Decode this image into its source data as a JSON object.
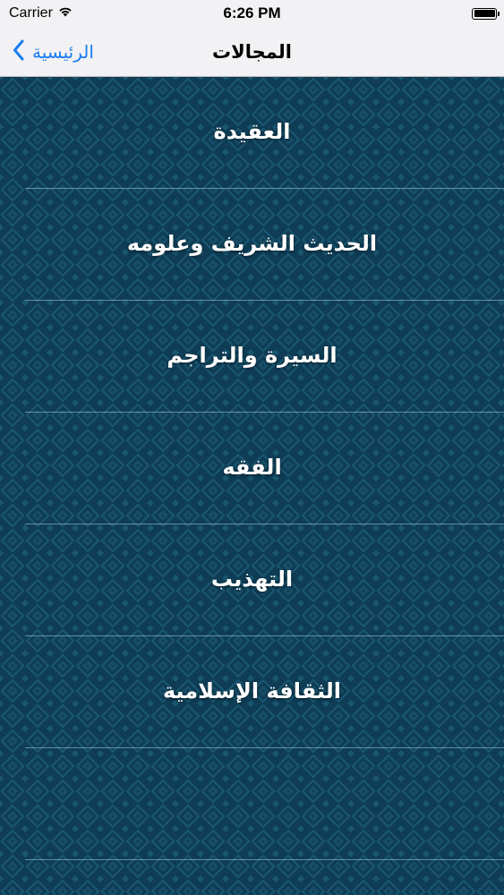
{
  "status_bar": {
    "carrier": "Carrier",
    "time": "6:26 PM",
    "wifi_icon": "wifi-icon",
    "battery_icon": "battery-icon",
    "battery_level": 1.0
  },
  "nav": {
    "title": "المجالات",
    "back_label": "الرئيسية",
    "back_icon": "chevron-left-icon",
    "accent_color": "#1a7cf2"
  },
  "list": {
    "items": [
      {
        "label": "العقيدة"
      },
      {
        "label": "الحديث الشريف وعلومه"
      },
      {
        "label": "السيرة والتراجم"
      },
      {
        "label": "الفقه"
      },
      {
        "label": "التهذيب"
      },
      {
        "label": "الثقافة الإسلامية"
      },
      {
        "label": ""
      }
    ]
  },
  "colors": {
    "background": "#0e3d55",
    "pattern": "#1a5670",
    "text": "#ffffff",
    "separator": "#aad2e6"
  }
}
